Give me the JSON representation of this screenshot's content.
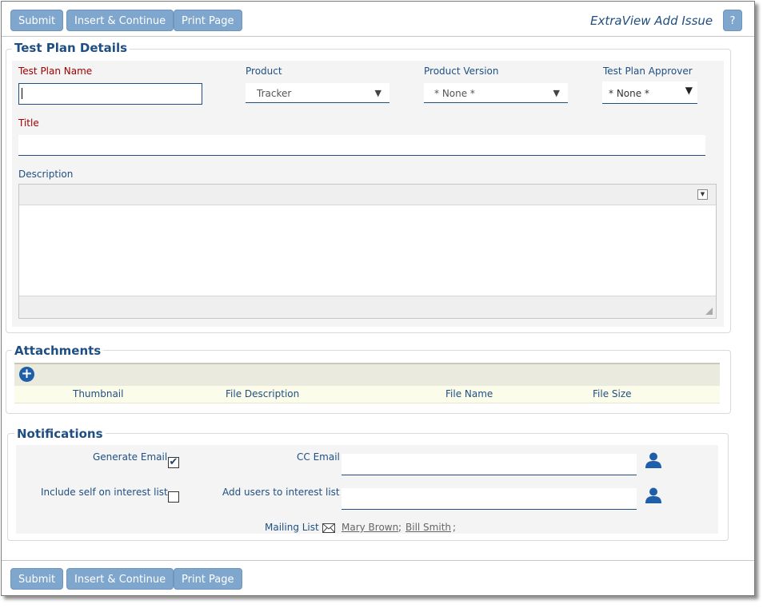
{
  "toolbar": {
    "submit_label": "Submit",
    "insert_label": "Insert & Continue",
    "print_label": "Print Page",
    "app_title": "ExtraView Add Issue",
    "help_label": "?"
  },
  "details": {
    "legend": "Test Plan Details",
    "test_plan_name_label": "Test Plan Name",
    "test_plan_name_value": "",
    "product_label": "Product",
    "product_value": "Tracker",
    "product_version_label": "Product Version",
    "product_version_value": "* None *",
    "approver_label": "Test Plan Approver",
    "approver_value": "* None *",
    "title_label": "Title",
    "title_value": "",
    "description_label": "Description"
  },
  "attachments": {
    "legend": "Attachments",
    "add_icon": "plus-circle-icon",
    "columns": [
      "Thumbnail",
      "File Description",
      "File Name",
      "File Size"
    ]
  },
  "notifications": {
    "legend": "Notifications",
    "generate_email_label": "Generate Email",
    "generate_email_checked": true,
    "include_self_label": "Include self on interest list",
    "include_self_checked": false,
    "cc_email_label": "CC Email",
    "add_users_label": "Add users to interest list",
    "mailing_list_label": "Mailing List",
    "mailing_list": [
      "Mary Brown",
      "Bill Smith"
    ],
    "mailing_list_separator": ";",
    "check_mark": "✔"
  },
  "colors": {
    "accent": "#1f4f82",
    "button": "#7fa6cd",
    "required": "#a00000"
  }
}
